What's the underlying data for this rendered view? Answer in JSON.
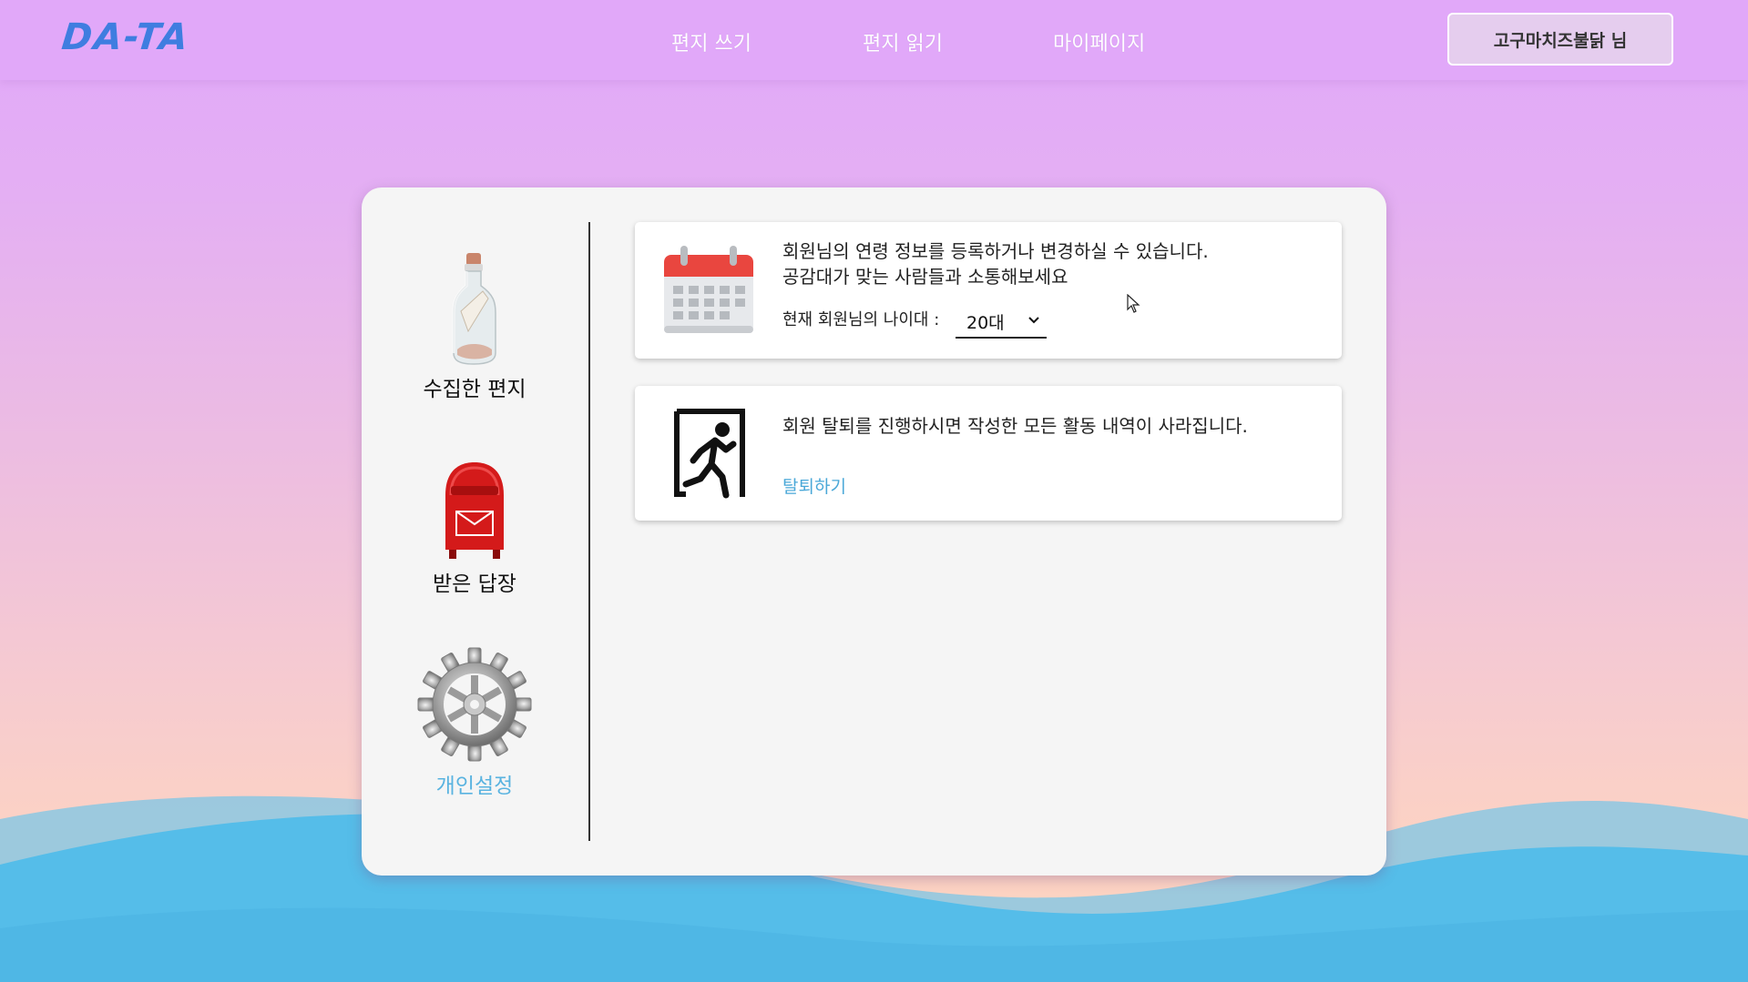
{
  "header": {
    "logo": "DA-TA",
    "nav": [
      {
        "label": "편지 쓰기"
      },
      {
        "label": "편지 읽기"
      },
      {
        "label": "마이페이지"
      }
    ],
    "user_button": "고구마치즈불닭 님"
  },
  "sidebar": {
    "items": [
      {
        "label": "수집한 편지",
        "icon": "bottle-letter-icon",
        "active": false
      },
      {
        "label": "받은 답장",
        "icon": "mailbox-icon",
        "active": false
      },
      {
        "label": "개인설정",
        "icon": "gear-icon",
        "active": true
      }
    ]
  },
  "age_panel": {
    "icon": "calendar-icon",
    "line1": "회원님의 연령 정보를 등록하거나 변경하실 수 있습니다.",
    "line2": "공감대가 맞는 사람들과 소통해보세요",
    "select_label": "현재 회원님의 나이대 :",
    "select_value": "20대"
  },
  "withdraw_panel": {
    "icon": "exit-icon",
    "text": "회원 탈퇴를 진행하시면 작성한 모든 활동 내역이 사라집니다.",
    "link": "탈퇴하기"
  },
  "colors": {
    "header_bg": "#e1a8f9",
    "logo": "#3f7de0",
    "accent": "#59b3e0",
    "wave": "#55bde9"
  }
}
